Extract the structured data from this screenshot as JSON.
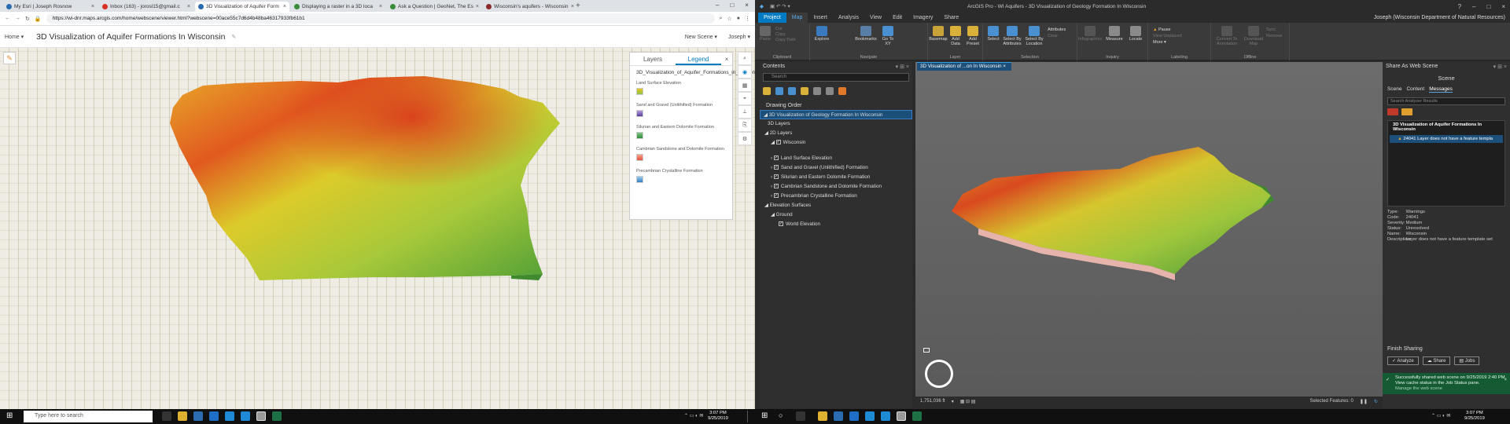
{
  "browser": {
    "tabs": [
      "My Esri | Joseph Rosnow",
      "Inbox (163) - jorosl15@gmail.c",
      "3D Visualization of Aquifer Form",
      "Displaying a raster in a 3D loca",
      "Ask a Question | GeoNet, The Es",
      "Wisconsin's aquifers - Wisconsin"
    ],
    "active_tab": 2,
    "url": "https://wi-dnr.maps.arcgis.com/home/webscene/viewer.html?webscene=00ace55c7d6d4b48ba46317933fb61b1"
  },
  "scene_viewer": {
    "home": "Home",
    "title": "3D Visualization of Aquifer Formations In Wisconsin",
    "new_scene": "New Scene",
    "user": "Joseph",
    "legend": {
      "tab_layers": "Layers",
      "tab_legend": "Legend",
      "layer_title": "3D_Visualization_of_Aquifer_Formations_in_Wisconsin_WTL1",
      "items": [
        {
          "label": "Land Surface Elevation",
          "color": "#e8c21c"
        },
        {
          "label": "Sand and Gravel (Unlithified) Formation",
          "color": "#5a3d9a"
        },
        {
          "label": "Silurian and Eastern Dolomite Formation",
          "color": "#2e8b3a"
        },
        {
          "label": "Cambrian Sandstone and Dolomite Formation",
          "color": "#e2533a"
        },
        {
          "label": "Precambrian Crystalline Formation",
          "color": "#2f7fc0"
        }
      ]
    }
  },
  "pro": {
    "window_title": "ArcGIS Pro - WI Aquifers - 3D Visualization of Geology Formation In Wisconsin",
    "ribbon_tabs": [
      "Project",
      "Map",
      "Insert",
      "Analysis",
      "View",
      "Edit",
      "Imagery",
      "Share"
    ],
    "active_ribbon_tab": "Map",
    "user": "Joseph (Wisconsin Department of Natural Resources)",
    "ribbon_groups": [
      {
        "label": "Clipboard",
        "buttons": [
          "Paste",
          "Cut",
          "Copy",
          "Copy Path"
        ]
      },
      {
        "label": "Navigate",
        "buttons": [
          "Explore",
          "Bookmarks",
          "Go To XY"
        ]
      },
      {
        "label": "Layer",
        "buttons": [
          "Basemap",
          "Add Data",
          "Add Preset"
        ]
      },
      {
        "label": "Selection",
        "buttons": [
          "Select",
          "Select By Attributes",
          "Select By Location",
          "Attributes",
          "Clear"
        ]
      },
      {
        "label": "Inquiry",
        "buttons": [
          "Infographics",
          "Measure",
          "Locate"
        ]
      },
      {
        "label": "Labeling",
        "buttons": [
          "Pause",
          "View Unplaced",
          "More"
        ]
      },
      {
        "label": "Offline",
        "buttons": [
          "Convert To Annotation",
          "Download Map",
          "Sync",
          "Remove"
        ]
      }
    ],
    "contents": {
      "title": "Contents",
      "search_placeholder": "Search",
      "drawing_order": "Drawing Order",
      "scene": "3D Visualization of Geology Formation In Wisconsin",
      "layers_3d": "3D Layers",
      "layers_2d": "2D Layers",
      "wisconsin": "Wisconsin",
      "items": [
        "Land Surface Elevation",
        "Sand and Gravel (Unlithified) Formation",
        "Silurian and Eastern Dolomite Formation",
        "Cambrian Sandstone and Dolomite Formation",
        "Precambrian Crystalline Formation"
      ],
      "elevation_surfaces": "Elevation Surfaces",
      "ground": "Ground",
      "world_elevation": "World Elevation"
    },
    "map_tab": "3D Visualization of ...on In Wisconsin",
    "scale": "1,751,036 ft",
    "selected_features": "Selected Features: 0",
    "share_panel": {
      "title": "Share As Web Scene",
      "subtitle": "Scene",
      "tabs": [
        "Scene",
        "Content",
        "Messages"
      ],
      "active_tab": "Messages",
      "search_placeholder": "Search Analyzer Results",
      "result_title": "3D Visualization of Aquifer Formations In Wisconsin",
      "result_msg": "24041 Layer does not have a feature templa",
      "details": [
        [
          "Type:",
          "Warnings"
        ],
        [
          "Code:",
          "24041"
        ],
        [
          "Severity:",
          "Medium"
        ],
        [
          "Status:",
          "Unresolved"
        ],
        [
          "Name:",
          "Wisconsin"
        ],
        [
          "Description:",
          "Layer does not have a feature template set"
        ]
      ],
      "finish": "Finish Sharing",
      "btn_analyze": "Analyze",
      "btn_share": "Share",
      "btn_jobs": "Jobs",
      "success_text": "Successfully shared web scene on 9/25/2019 2:40 PM. View cache status in the Job Status pane.",
      "manage_link": "Manage the web scene"
    }
  },
  "taskbar": {
    "search_placeholder": "Type here to search",
    "time_left": "3:07 PM",
    "date_left": "9/25/2019",
    "time_right": "3:07 PM",
    "date_right": "9/25/2019"
  }
}
